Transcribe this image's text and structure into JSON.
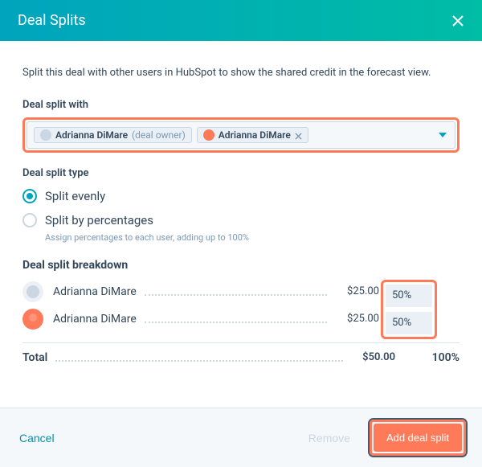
{
  "header": {
    "title": "Deal Splits"
  },
  "intro": "Split this deal with other users in HubSpot to show the shared credit in the forecast view.",
  "splitWith": {
    "label": "Deal split with",
    "chips": [
      {
        "name": "Adrianna DiMare",
        "suffix": "(deal owner)",
        "removable": false,
        "avatar": "gray"
      },
      {
        "name": "Adrianna DiMare",
        "suffix": "",
        "removable": true,
        "avatar": "orange"
      }
    ]
  },
  "splitType": {
    "label": "Deal split type",
    "options": [
      {
        "label": "Split evenly",
        "checked": true
      },
      {
        "label": "Split by percentages",
        "checked": false
      }
    ],
    "helper": "Assign percentages to each user, adding up to 100%"
  },
  "breakdown": {
    "label": "Deal split breakdown",
    "rows": [
      {
        "name": "Adrianna DiMare",
        "amount": "$25.00",
        "pct": "50%",
        "avatar": "gray"
      },
      {
        "name": "Adrianna DiMare",
        "amount": "$25.00",
        "pct": "50%",
        "avatar": "orange"
      }
    ],
    "total": {
      "label": "Total",
      "amount": "$50.00",
      "pct": "100%"
    }
  },
  "footer": {
    "cancel": "Cancel",
    "remove": "Remove",
    "primary": "Add deal split"
  }
}
